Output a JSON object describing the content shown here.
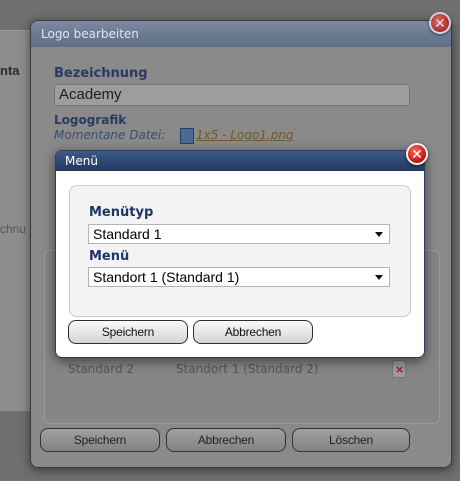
{
  "background": {
    "tab_fragment": "nta",
    "side_fragment": "chnu"
  },
  "outer_dialog": {
    "title": "Logo bearbeiten",
    "close_glyph": "✕",
    "fields": {
      "bezeichnung_label": "Bezeichnung",
      "bezeichnung_value": "Academy",
      "logografik_label": "Logografik",
      "current_file_label": "Momentane Datei:",
      "current_file_name": "1x5 - Logo1.png"
    },
    "menu_row": {
      "menutyp": "Standard 2",
      "menu": "Standort 1 (Standard 2)"
    },
    "buttons": {
      "save": "Speichern",
      "cancel": "Abbrechen",
      "delete": "Löschen"
    }
  },
  "menu_dialog": {
    "title": "Menü",
    "close_glyph": "✕",
    "menutyp_label": "Menütyp",
    "menutyp_value": "Standard 1",
    "menu_label": "Menü",
    "menu_value": "Standort 1 (Standard 1)",
    "buttons": {
      "save": "Speichern",
      "cancel": "Abbrechen"
    }
  },
  "colors": {
    "title_bar": "#22385f",
    "label_blue": "#1f3468",
    "close_red": "#c1120a"
  }
}
